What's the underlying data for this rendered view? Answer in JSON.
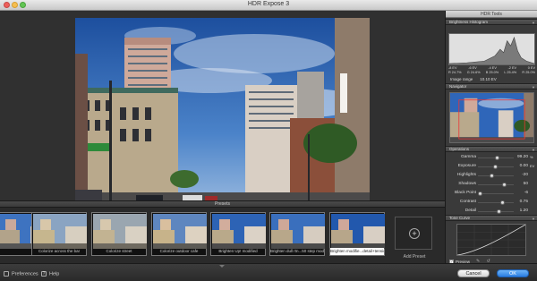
{
  "window": {
    "title": "HDR Expose 3"
  },
  "panel": {
    "title": "HDR Tools",
    "histogram": {
      "header": "Brightness Histogram",
      "ev_labels": [
        "-8 EV",
        "-6 EV",
        "-4 EV",
        "-2 EV",
        "0 EV"
      ],
      "pct_labels": [
        "R 24.7%",
        "G 24.6%",
        "B 25.0%",
        "L 25.4%",
        "R 25.0%"
      ],
      "range_label": "Image range",
      "range_value": "10.10 EV"
    },
    "navigator": {
      "header": "Navigator"
    },
    "operations": {
      "header": "Operations",
      "sliders": [
        {
          "label": "Gamma",
          "value": "99.20",
          "unit": "%",
          "pos": 0.55
        },
        {
          "label": "Exposure",
          "value": "0.00",
          "unit": "EV",
          "pos": 0.5
        },
        {
          "label": "Highlights",
          "value": "-20",
          "unit": "",
          "pos": 0.4
        },
        {
          "label": "Shadows",
          "value": "50",
          "unit": "",
          "pos": 0.75
        },
        {
          "label": "Black Point",
          "value": "-6",
          "unit": "",
          "pos": 0.08
        },
        {
          "label": "Contrast",
          "value": "0.75",
          "unit": "",
          "pos": 0.7
        },
        {
          "label": "Detail",
          "value": "1.20",
          "unit": "",
          "pos": 0.6
        }
      ]
    },
    "tone_curve": {
      "header": "Tone Curve",
      "preview_label": "Preview",
      "preview_checked": "✓"
    }
  },
  "presets": {
    "header": "Presets",
    "items": [
      {
        "label": ""
      },
      {
        "label": "Colorize across the bar"
      },
      {
        "label": "Colorize street"
      },
      {
        "label": "Colorize outdoor cafe"
      },
      {
        "label": "Brighten Up! modified"
      },
      {
        "label": "Brighten dull rtn...50 step modified"
      },
      {
        "label": "Brighten modifie...detail+tensions",
        "selected": true
      }
    ],
    "add_label": "Add Preset"
  },
  "bottom": {
    "preferences": "Preferences",
    "help": "Help",
    "help_icon": "?",
    "cancel": "Cancel",
    "ok": "OK"
  }
}
